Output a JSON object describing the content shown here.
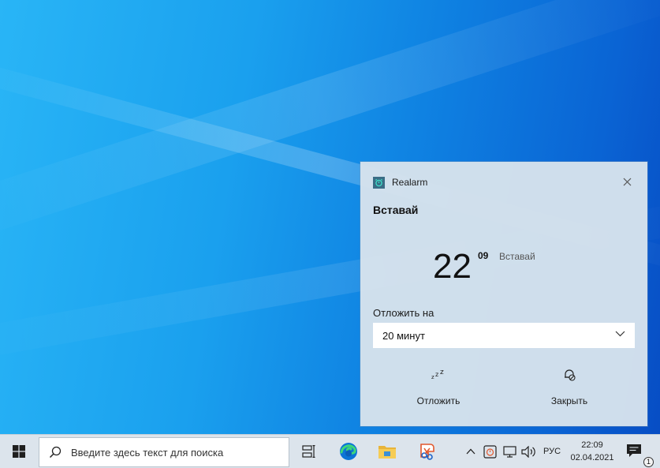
{
  "toast": {
    "app_name": "Realarm",
    "title": "Вставай",
    "hours": "22",
    "minutes": "09",
    "alarm_label": "Вставай",
    "snooze_label": "Отложить на",
    "snooze_value": "20 минут",
    "snooze_button": "Отложить",
    "dismiss_button": "Закрыть"
  },
  "taskbar": {
    "search_placeholder": "Введите здесь текст для поиска",
    "language": "РУС",
    "time": "22:09",
    "date": "02.04.2021",
    "notification_count": "1"
  },
  "colors": {
    "accent": "#0078d7",
    "app_icon_bg": "#3a6d86",
    "app_icon_fg": "#3fe0c8",
    "taskbar_bg": "#dce4ec",
    "toast_bg": "#d6e2ec"
  },
  "icons": {
    "start": "windows-logo-icon",
    "search": "search-icon",
    "task_view": "task-view-icon",
    "edge": "edge-browser-icon",
    "explorer": "file-explorer-icon",
    "snip": "snipping-tool-icon",
    "tray_overflow": "chevron-up-icon",
    "tray_app": "realarm-tray-icon",
    "network": "network-icon",
    "volume": "volume-icon",
    "notifications": "action-center-icon",
    "snooze": "zzz-icon",
    "dismiss": "alarm-off-icon",
    "close": "close-icon"
  }
}
